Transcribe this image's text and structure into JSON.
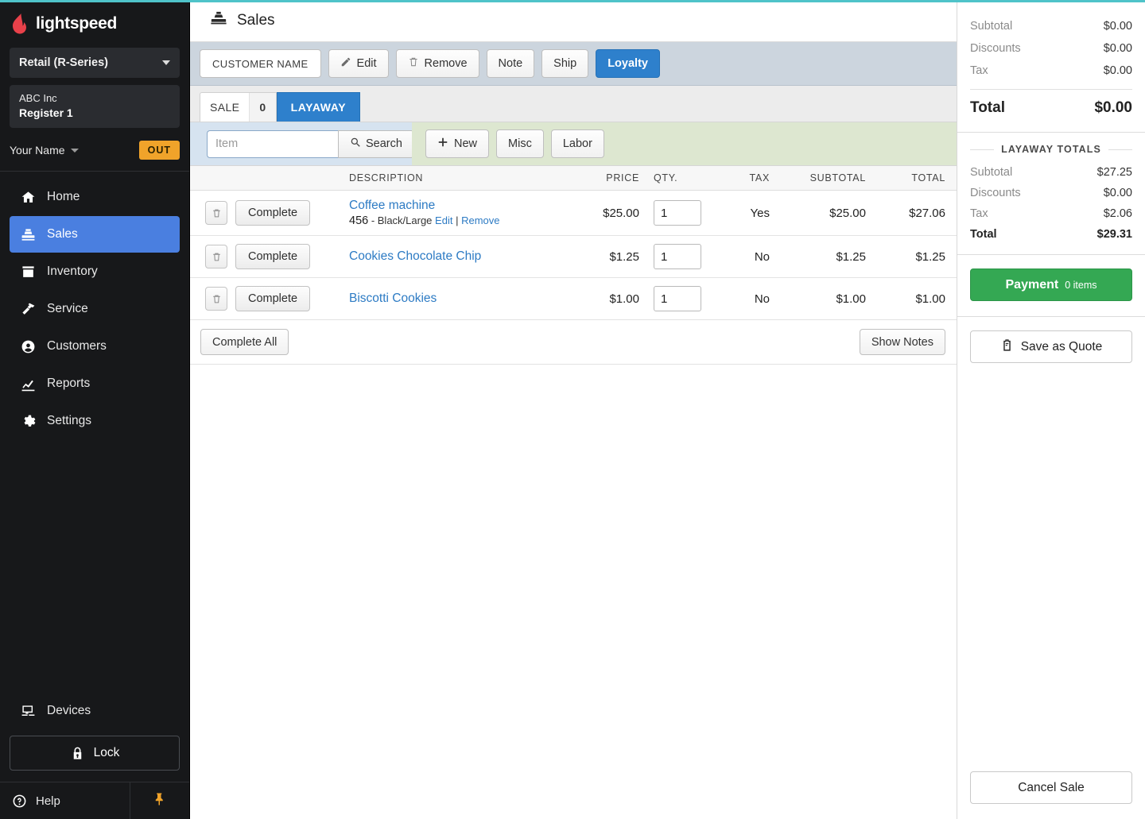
{
  "theme": {
    "accent_top": "#4fc3c9",
    "sidebar_bg": "#17181a",
    "active_nav": "#4a7fe0",
    "primary_blue": "#2e80cc",
    "payment_green": "#34a853",
    "out_badge": "#f0a32a",
    "toolbar_bg": "#ccd5de",
    "search_left_bg": "#d6e3f0",
    "search_right_bg": "#dde7d0"
  },
  "sidebar": {
    "brand": "lightspeed",
    "store_select": "Retail (R-Series)",
    "register": {
      "company": "ABC Inc",
      "name": "Register 1"
    },
    "user": {
      "name": "Your Name",
      "status_badge": "OUT"
    },
    "nav": [
      {
        "label": "Home",
        "icon": "home-icon",
        "active": false
      },
      {
        "label": "Sales",
        "icon": "cash-register-icon",
        "active": true
      },
      {
        "label": "Inventory",
        "icon": "inventory-box-icon",
        "active": false
      },
      {
        "label": "Service",
        "icon": "hammer-icon",
        "active": false
      },
      {
        "label": "Customers",
        "icon": "user-circle-icon",
        "active": false
      },
      {
        "label": "Reports",
        "icon": "chart-line-icon",
        "active": false
      },
      {
        "label": "Settings",
        "icon": "gear-icon",
        "active": false
      }
    ],
    "devices": {
      "label": "Devices",
      "icon": "monitor-icon"
    },
    "lock": {
      "label": "Lock",
      "icon": "lock-icon"
    },
    "help": {
      "label": "Help",
      "icon": "question-circle-icon"
    },
    "pin": {
      "icon": "pin-icon"
    }
  },
  "header": {
    "title": "Sales",
    "icon": "cash-register-icon"
  },
  "toolbar": {
    "customer_name": "CUSTOMER NAME",
    "edit": "Edit",
    "remove": "Remove",
    "note": "Note",
    "ship": "Ship",
    "loyalty": "Loyalty"
  },
  "tabs": {
    "sale_label": "SALE",
    "sale_count": "0",
    "layaway_label": "LAYAWAY",
    "active": "LAYAWAY"
  },
  "search": {
    "item_placeholder": "Item",
    "item_value": "",
    "search_label": "Search",
    "new_label": "New",
    "misc_label": "Misc",
    "labor_label": "Labor"
  },
  "table": {
    "columns": {
      "description": "DESCRIPTION",
      "price": "PRICE",
      "qty": "QTY.",
      "tax": "TAX",
      "subtotal": "SUBTOTAL",
      "total": "TOTAL"
    },
    "complete_label": "Complete",
    "rows": [
      {
        "name": "Coffee machine",
        "sku": "456",
        "variant": "Black/Large",
        "edit_label": "Edit",
        "remove_label": "Remove",
        "price": "$25.00",
        "qty": "1",
        "tax": "Yes",
        "subtotal": "$25.00",
        "total": "$27.06",
        "has_detail": true
      },
      {
        "name": "Cookies Chocolate Chip",
        "sku": "",
        "variant": "",
        "edit_label": "",
        "remove_label": "",
        "price": "$1.25",
        "qty": "1",
        "tax": "No",
        "subtotal": "$1.25",
        "total": "$1.25",
        "has_detail": false
      },
      {
        "name": "Biscotti Cookies",
        "sku": "",
        "variant": "",
        "edit_label": "",
        "remove_label": "",
        "price": "$1.00",
        "qty": "1",
        "tax": "No",
        "subtotal": "$1.00",
        "total": "$1.00",
        "has_detail": false
      }
    ],
    "complete_all_label": "Complete All",
    "show_notes_label": "Show Notes"
  },
  "right_panel": {
    "sale_totals": {
      "subtotal_label": "Subtotal",
      "subtotal_value": "$0.00",
      "discounts_label": "Discounts",
      "discounts_value": "$0.00",
      "tax_label": "Tax",
      "tax_value": "$0.00",
      "total_label": "Total",
      "total_value": "$0.00"
    },
    "layaway_totals": {
      "heading": "LAYAWAY TOTALS",
      "subtotal_label": "Subtotal",
      "subtotal_value": "$27.25",
      "discounts_label": "Discounts",
      "discounts_value": "$0.00",
      "tax_label": "Tax",
      "tax_value": "$2.06",
      "total_label": "Total",
      "total_value": "$29.31"
    },
    "payment_label": "Payment",
    "payment_items": "0 items",
    "save_quote_label": "Save as Quote",
    "cancel_sale_label": "Cancel Sale"
  }
}
